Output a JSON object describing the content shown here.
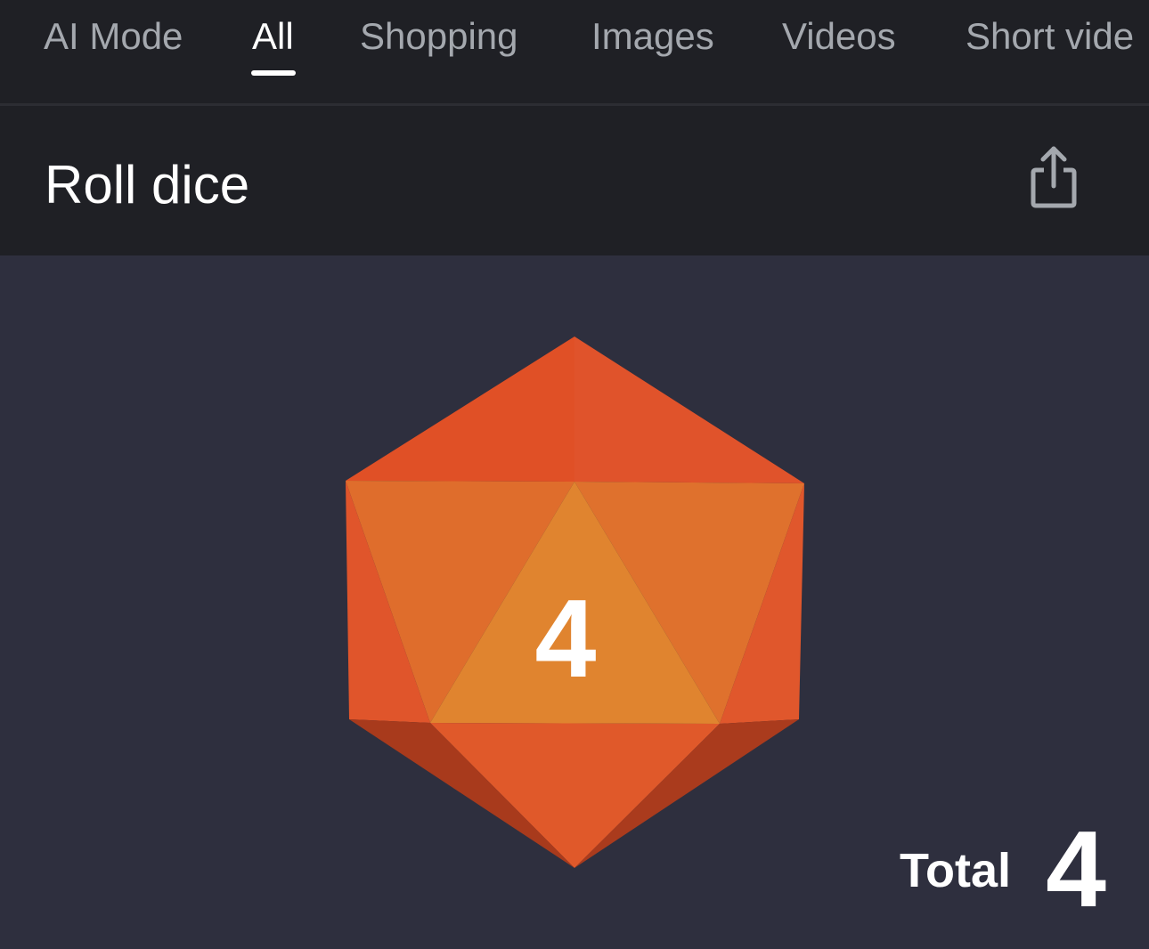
{
  "nav": {
    "tabs": [
      {
        "label": "AI Mode"
      },
      {
        "label": "All"
      },
      {
        "label": "Shopping"
      },
      {
        "label": "Images"
      },
      {
        "label": "Videos"
      },
      {
        "label": "Short vide"
      }
    ],
    "active_tab": "All"
  },
  "header": {
    "title": "Roll dice",
    "share_icon": "share-icon"
  },
  "dice": {
    "type": "d20-icosahedron",
    "face_value": "4",
    "color": "#e2572b"
  },
  "result": {
    "total_label": "Total",
    "total_value": "4"
  },
  "colors": {
    "background": "#2e2f3e",
    "bar": "#1f2025",
    "tab_inactive": "#a4a8ae",
    "text": "#ffffff"
  }
}
